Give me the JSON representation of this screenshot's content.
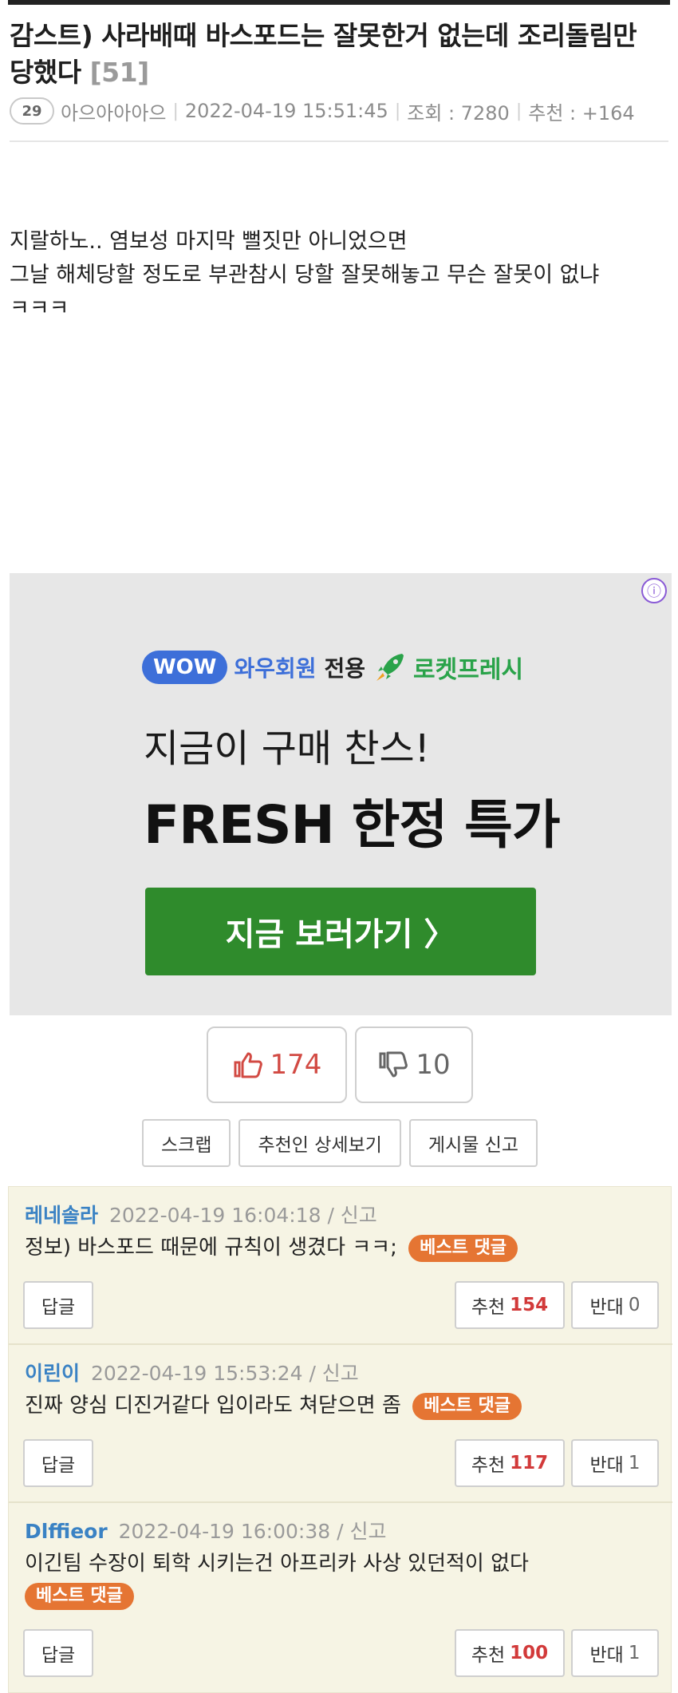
{
  "post": {
    "title": "감스트) 사라배때 바스포드는 잘못한거 없는데 조리돌림만 당했다",
    "comment_count": "[51]",
    "level": "29",
    "author": "아으아아아으",
    "date": "2022-04-19 15:51:45",
    "views": "조회 : 7280",
    "recommend": "추천 : +164",
    "body_lines": [
      "지랄하노.. 염보성 마지막 뻘짓만 아니었으면",
      "그날 해체당할 정도로 부관참시 당할 잘못해놓고 무슨 잘못이 없냐",
      "ㅋㅋㅋ"
    ]
  },
  "ad": {
    "info": "ⓘ",
    "wow": "WOW",
    "member": "와우회원",
    "only": "전용",
    "rocket": "로켓프레시",
    "line1": "지금이 구매 찬스!",
    "line2": "FRESH 한정 특가",
    "cta": "지금 보러가기 〉",
    "colors": {
      "wow": "#3d6fd9",
      "rocket": "#2aa34a",
      "cta": "#2f8b2c"
    }
  },
  "votes": {
    "up": "174",
    "down": "10"
  },
  "actions": {
    "scrap": "스크랩",
    "recommenders": "추천인 상세보기",
    "report": "게시물 신고"
  },
  "comments": [
    {
      "author": "레네솔라",
      "date": "2022-04-19 16:04:18",
      "report": "/ 신고",
      "text": "정보) 바스포드 때문에 규칙이 생겼다 ㅋㅋ;",
      "best": "베스트 댓글",
      "reply": "답글",
      "up_label": "추천",
      "up": "154",
      "down_label": "반대",
      "down": "0"
    },
    {
      "author": "이린이",
      "date": "2022-04-19 15:53:24",
      "report": "/ 신고",
      "text": "진짜 양심 디진거같다 입이라도 쳐닫으면 좀",
      "best": "베스트 댓글",
      "reply": "답글",
      "up_label": "추천",
      "up": "117",
      "down_label": "반대",
      "down": "1"
    },
    {
      "author": "Dlffieor",
      "date": "2022-04-19 16:00:38",
      "report": "/ 신고",
      "text": "이긴팀 수장이 퇴학 시키는건 아프리카 사상 있던적이 없다",
      "best": "베스트 댓글",
      "reply": "답글",
      "up_label": "추천",
      "up": "100",
      "down_label": "반대",
      "down": "1"
    }
  ]
}
